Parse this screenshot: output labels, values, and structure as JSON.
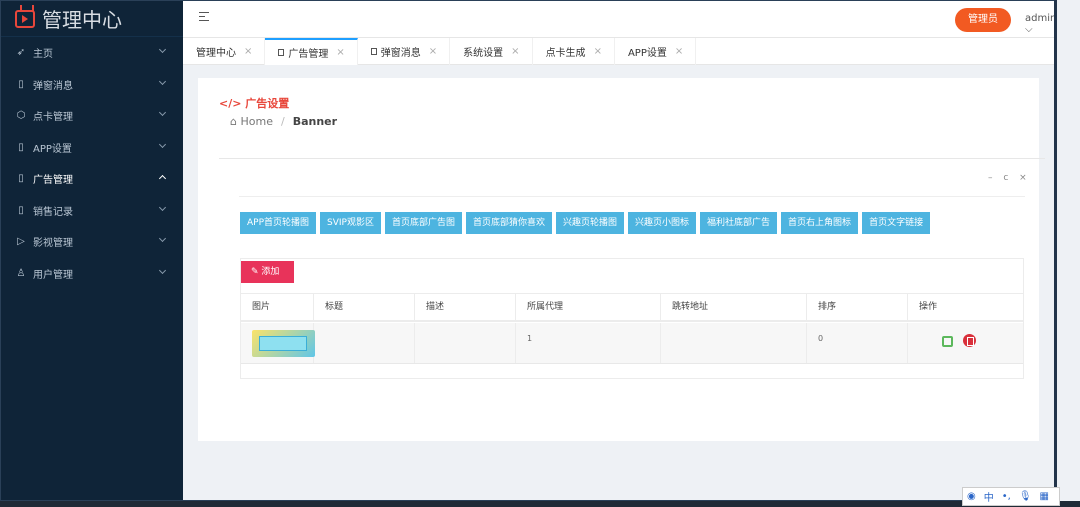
{
  "app": {
    "title": "管理中心"
  },
  "sidebar": {
    "items": [
      {
        "label": "主页"
      },
      {
        "label": "弹窗消息"
      },
      {
        "label": "点卡管理"
      },
      {
        "label": "APP设置"
      },
      {
        "label": "广告管理"
      },
      {
        "label": "销售记录"
      },
      {
        "label": "影视管理"
      },
      {
        "label": "用户管理"
      }
    ]
  },
  "header": {
    "role_button": "管理员",
    "user": "admin"
  },
  "tabs": [
    {
      "label": "管理中心"
    },
    {
      "label": "广告管理"
    },
    {
      "label": "弹窗消息"
    },
    {
      "label": "系统设置"
    },
    {
      "label": "点卡生成"
    },
    {
      "label": "APP设置"
    }
  ],
  "page": {
    "title": "广告设置",
    "breadcrumb": {
      "home": "Home",
      "separator": "/",
      "current": "Banner"
    },
    "widget_tools": "– c ×"
  },
  "categories": [
    "APP首页轮播图",
    "SVIP观影区",
    "首页底部广告图",
    "首页底部猜你喜欢",
    "兴趣页轮播图",
    "兴趣页小图标",
    "福利社底部广告",
    "首页右上角图标",
    "首页文字链接"
  ],
  "add_button": "添加",
  "table": {
    "headers": [
      "图片",
      "标题",
      "描述",
      "所属代理",
      "跳转地址",
      "排序",
      "操作"
    ],
    "rows": [
      {
        "title": "",
        "desc": "",
        "agent": "1",
        "url": "",
        "order": "0"
      }
    ]
  }
}
